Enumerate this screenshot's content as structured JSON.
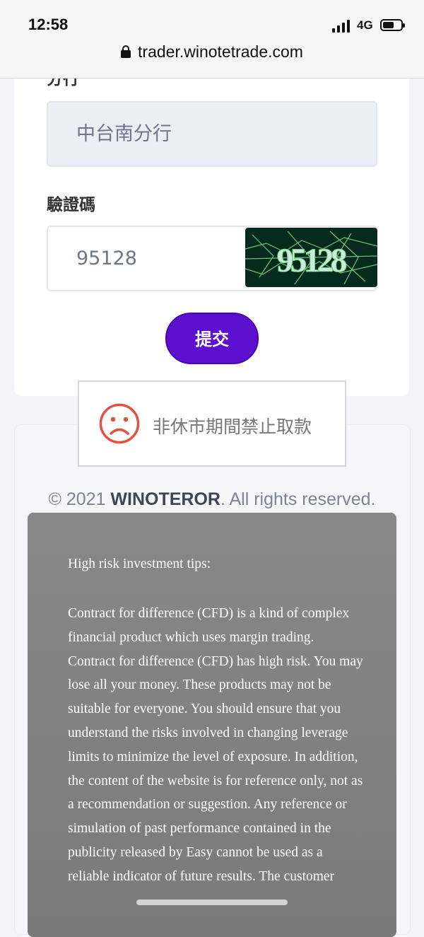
{
  "status_bar": {
    "time": "12:58",
    "network": "4G"
  },
  "browser": {
    "url": "trader.winotetrade.com"
  },
  "form": {
    "branch_label": "分行",
    "branch_value": "中台南分行",
    "captcha_label": "驗證碼",
    "captcha_value": "95128",
    "captcha_image_text": "95128",
    "submit_label": "提交"
  },
  "toast": {
    "icon": "sad-face-icon",
    "message": "非休市期間禁止取款"
  },
  "footer": {
    "prefix": "© 2021 ",
    "brand": "WINOTEROR",
    "suffix": ". All rights reserved."
  },
  "risk": {
    "title": "High risk investment tips:",
    "body": "Contract for difference (CFD) is a kind of complex financial product which uses margin trading. Contract for difference (CFD) has high risk. You may lose all your money. These products may not be suitable for everyone. You should ensure that you understand the risks involved in changing leverage limits to minimize the level of exposure. In addition, the content of the website is for reference only, not as a recommendation or suggestion. Any reference or simulation of past performance contained in the publicity released by Easy cannot be used as a reliable indicator of future results. The customer"
  },
  "colors": {
    "accent": "#5b0fcf",
    "risk_bg": "#808080",
    "toast_icon": "#e0533f"
  }
}
